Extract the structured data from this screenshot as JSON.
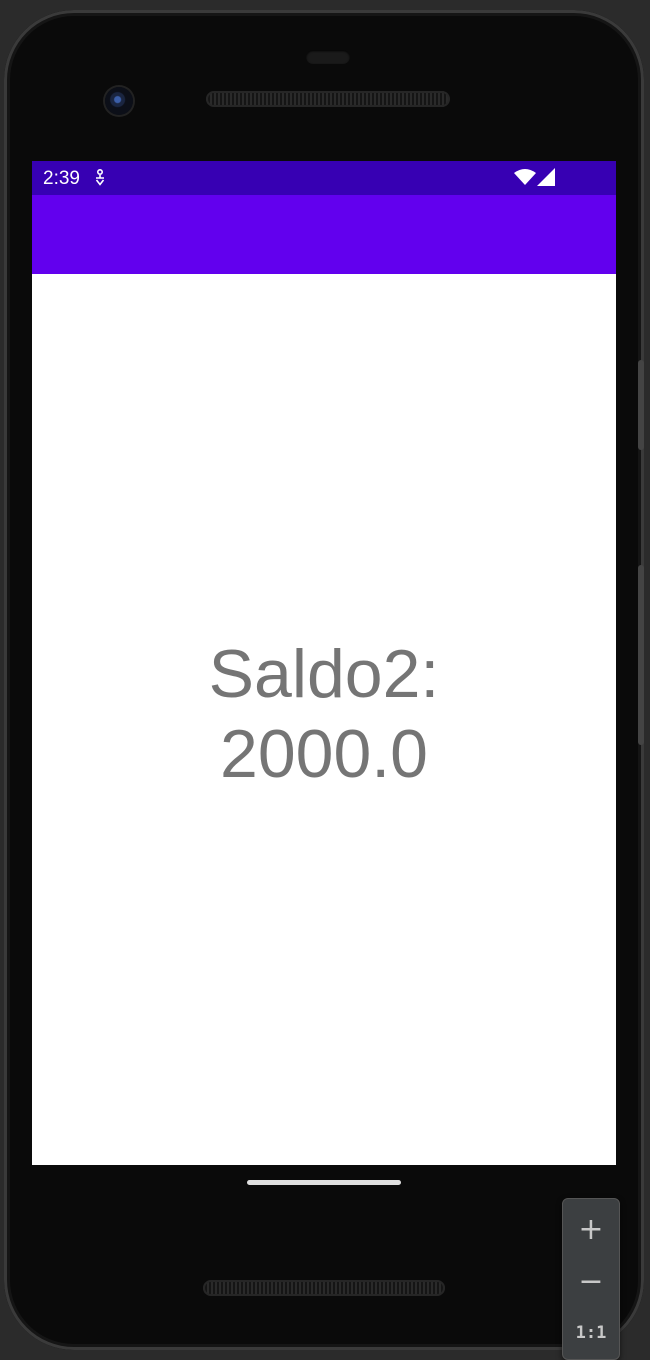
{
  "status_bar": {
    "time": "2:39",
    "notification_icon": "accessibility-icon",
    "wifi_icon": "wifi-icon",
    "signal_icon": "cell-signal-icon"
  },
  "app_bar": {
    "color": "#6200ee"
  },
  "status_bar_color": "#3700b3",
  "content": {
    "saldo_text": "Saldo2: 2000.0"
  },
  "emulator_controls": {
    "zoom_in": "+",
    "zoom_out": "−",
    "actual_size": "1:1"
  }
}
